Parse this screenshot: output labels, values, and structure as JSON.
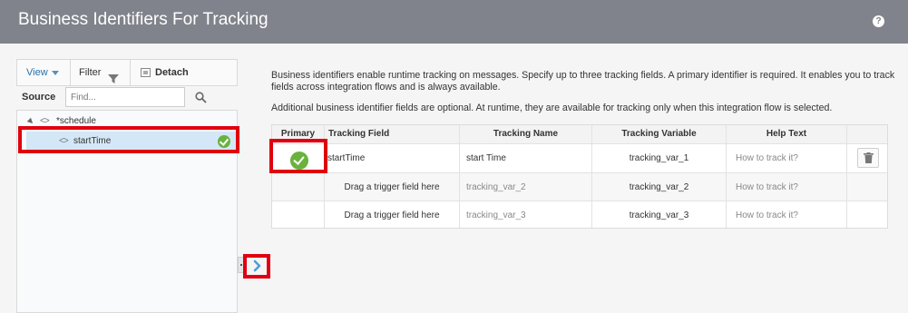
{
  "window": {
    "title": "Business Identifiers For Tracking",
    "help_icon": "help-icon"
  },
  "left_panel": {
    "toolbar": {
      "view_label": "View",
      "filter_label": "Filter",
      "detach_label": "Detach"
    },
    "source_label": "Source",
    "find_placeholder": "Find...",
    "tree": [
      {
        "label": "*schedule",
        "icon": "code-icon"
      },
      {
        "label": "startTime",
        "icon": "code-icon",
        "selected": true,
        "mapped": true
      }
    ]
  },
  "description": {
    "para1": "Business identifiers enable runtime tracking on messages. Specify up to three tracking fields. A primary identifier is required. It enables you to track fields across integration flows and is always available.",
    "para2": "Additional business identifier fields are optional. At runtime, they are available for tracking only when this integration flow is selected."
  },
  "table": {
    "columns": [
      "Primary",
      "Tracking Field",
      "Tracking Name",
      "Tracking Variable",
      "Help Text"
    ],
    "rows": [
      {
        "primary": true,
        "field": "startTime",
        "name": "start Time",
        "variable": "tracking_var_1",
        "help": "How to track it?",
        "deletable": true
      },
      {
        "primary": false,
        "field": "Drag a trigger field here",
        "name": "tracking_var_2",
        "variable": "tracking_var_2",
        "help": "How to track it?",
        "deletable": false
      },
      {
        "primary": false,
        "field": "Drag a trigger field here",
        "name": "tracking_var_3",
        "variable": "tracking_var_3",
        "help": "How to track it?",
        "deletable": false
      }
    ]
  },
  "colors": {
    "title_bar": "#80838b",
    "highlight": "#e0000f",
    "check_green": "#6ab23d",
    "selection": "#d4e7f7"
  }
}
